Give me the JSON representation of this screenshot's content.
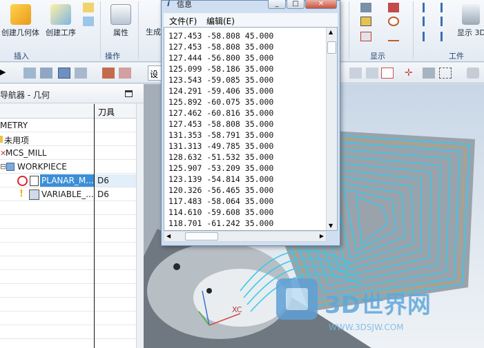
{
  "ribbon": {
    "create_geometry": "创建几何体",
    "create_operation": "创建工序",
    "properties": "属性",
    "generate": "生成",
    "show3d": "显示 3D",
    "groups": {
      "insert": "插入",
      "operation": "操作",
      "display": "显示",
      "tools": "工件"
    }
  },
  "toolbar2": {
    "setting_label": "设"
  },
  "navigator": {
    "title": "导航器 - 几何",
    "col_tool": "刀具",
    "rows": [
      {
        "name": "METRY",
        "tool": ""
      },
      {
        "name": "未用项",
        "tool": ""
      },
      {
        "name": "MCS_MILL",
        "tool": ""
      },
      {
        "name": "WORKPIECE",
        "tool": ""
      },
      {
        "name": "PLANAR_M...",
        "tool": "D6",
        "selected": true
      },
      {
        "name": "VARIABLE_...",
        "tool": "D6"
      }
    ]
  },
  "info_window": {
    "title": "信息",
    "menu": {
      "file": "文件(F)",
      "edit": "编辑(E)"
    },
    "lines": [
      "127.453 -58.808 45.000",
      "127.453 -58.808 35.000",
      "127.444 -56.800 35.000",
      "125.099 -58.186 35.000",
      "123.543 -59.085 35.000",
      "124.291 -59.406 35.000",
      "125.892 -60.075 35.000",
      "127.462 -60.816 35.000",
      "127.453 -58.808 35.000",
      "131.353 -58.791 35.000",
      "131.313 -49.785 35.000",
      "128.632 -51.532 35.000",
      "125.907 -53.209 35.000",
      "123.139 -54.814 35.000",
      "120.326 -56.465 35.000",
      "117.483 -58.064 35.000",
      "114.610 -59.608 35.000",
      "118.701 -61.242 35.000"
    ]
  },
  "graphics": {
    "axis_label": "XC",
    "watermark_main": "3D世界网",
    "watermark_url": "WWW.3DSJW.COM"
  },
  "colors": {
    "toolpath": "#39c9ea",
    "selected_row": "#3c8fd6",
    "model": "#8f969c"
  }
}
